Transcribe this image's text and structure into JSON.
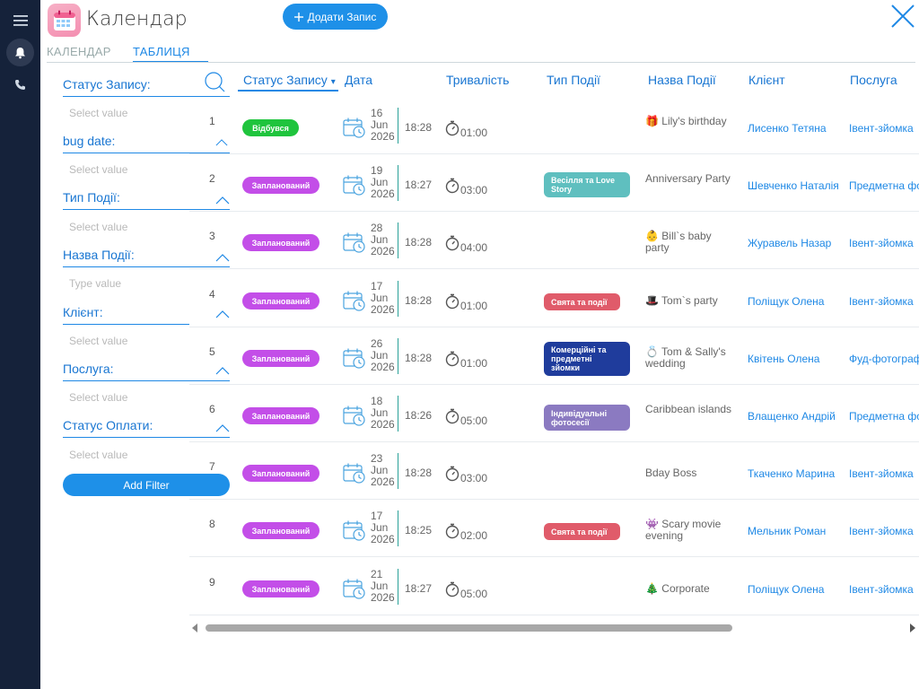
{
  "app": {
    "title": "Календар",
    "add_button_label": "Додати Запис"
  },
  "rail": {
    "items": [
      "menu-icon",
      "bell-icon",
      "phone-icon"
    ]
  },
  "tabs": [
    {
      "label": "КАЛЕНДАР",
      "active": false
    },
    {
      "label": "ТАБЛИЦЯ",
      "active": true
    }
  ],
  "filters": {
    "items": [
      {
        "label": "Статус Запису:",
        "placeholder": "Select value"
      },
      {
        "label": "bug date:",
        "placeholder": "Select value"
      },
      {
        "label": "Тип Події:",
        "placeholder": "Select value"
      },
      {
        "label": "Назва Події:",
        "placeholder": "Type value"
      },
      {
        "label": "Клієнт:",
        "placeholder": "Select value"
      },
      {
        "label": "Послуга:",
        "placeholder": "Select value"
      },
      {
        "label": "Статус Оплати:",
        "placeholder": "Select value"
      }
    ],
    "add_filter_label": "Add Filter"
  },
  "table": {
    "columns": [
      "Статус Запису",
      "Дата",
      "Тривалість",
      "Тип Події",
      "Назва Події",
      "Клієнт",
      "Послуга"
    ],
    "sort_indicator": "▾",
    "rows": [
      {
        "num": "1",
        "status": "Відбувся",
        "status_color": "#1fc43d",
        "day": "16",
        "month": "Jun",
        "year": "2026",
        "time": "18:28",
        "duration": "01:00",
        "event_type": "",
        "event_type_color": "",
        "event_name": "🎁 Lily's birthday",
        "client": "Лисенко Тетяна",
        "service": "Івент-зйомка"
      },
      {
        "num": "2",
        "status": "Запланований",
        "status_color": "#c34ee8",
        "day": "19",
        "month": "Jun",
        "year": "2026",
        "time": "18:27",
        "duration": "03:00",
        "event_type": "Весілля та Love Story",
        "event_type_color": "#5fbfbf",
        "event_name": "Anniversary Party",
        "client": "Шевченко Наталія",
        "service": "Предметна фо"
      },
      {
        "num": "3",
        "status": "Запланований",
        "status_color": "#c34ee8",
        "day": "28",
        "month": "Jun",
        "year": "2026",
        "time": "18:28",
        "duration": "04:00",
        "event_type": "",
        "event_type_color": "",
        "event_name": "👶 Bill`s baby party",
        "client": "Журавель Назар",
        "service": "Івент-зйомка"
      },
      {
        "num": "4",
        "status": "Запланований",
        "status_color": "#c34ee8",
        "day": "17",
        "month": "Jun",
        "year": "2026",
        "time": "18:28",
        "duration": "01:00",
        "event_type": "Свята та події",
        "event_type_color": "#e05b6a",
        "event_name": "🎩 Tom`s party",
        "client": "Поліщук Олена",
        "service": "Івент-зйомка"
      },
      {
        "num": "5",
        "status": "Запланований",
        "status_color": "#c34ee8",
        "day": "26",
        "month": "Jun",
        "year": "2026",
        "time": "18:28",
        "duration": "01:00",
        "event_type": "Комерційні та предметні зйомки",
        "event_type_color": "#1f3c9c",
        "event_name": "💍 Tom & Sally's wedding",
        "client": "Квітень Олена",
        "service": "Фуд-фотограф"
      },
      {
        "num": "6",
        "status": "Запланований",
        "status_color": "#c34ee8",
        "day": "18",
        "month": "Jun",
        "year": "2026",
        "time": "18:26",
        "duration": "05:00",
        "event_type": "Індивідуальні фотосесії",
        "event_type_color": "#8b7ac1",
        "event_name": "Caribbean islands",
        "client": "Влащенко Андрій",
        "service": "Предметна фо"
      },
      {
        "num": "7",
        "status": "Запланований",
        "status_color": "#c34ee8",
        "day": "23",
        "month": "Jun",
        "year": "2026",
        "time": "18:28",
        "duration": "03:00",
        "event_type": "",
        "event_type_color": "",
        "event_name": "Bday Boss",
        "client": "Ткаченко Марина",
        "service": "Івент-зйомка"
      },
      {
        "num": "8",
        "status": "Запланований",
        "status_color": "#c34ee8",
        "day": "17",
        "month": "Jun",
        "year": "2026",
        "time": "18:25",
        "duration": "02:00",
        "event_type": "Свята та події",
        "event_type_color": "#e05b6a",
        "event_name": "👾 Scary movie evening",
        "client": "Мельник Роман",
        "service": "Івент-зйомка"
      },
      {
        "num": "9",
        "status": "Запланований",
        "status_color": "#c34ee8",
        "day": "21",
        "month": "Jun",
        "year": "2026",
        "time": "18:27",
        "duration": "05:00",
        "event_type": "",
        "event_type_color": "",
        "event_name": "🎄 Corporate",
        "client": "Поліщук Олена",
        "service": "Івент-зйомка"
      }
    ]
  }
}
